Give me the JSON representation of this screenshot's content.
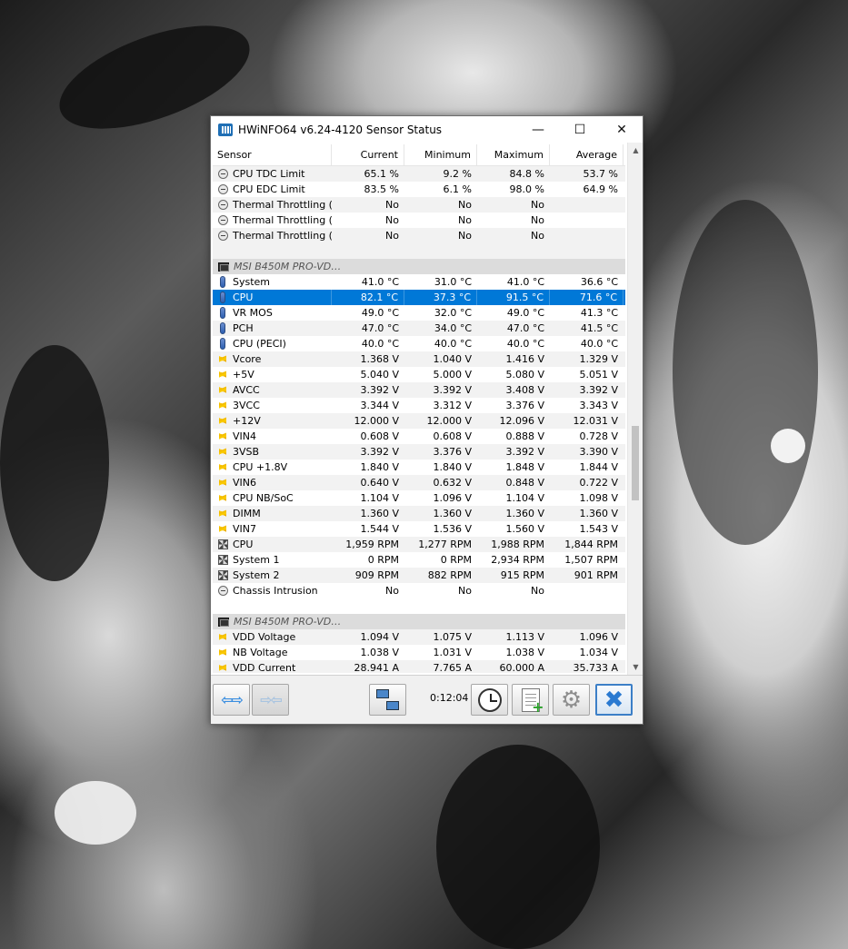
{
  "window": {
    "title": "HWiNFO64 v6.24-4120 Sensor Status",
    "minimize": "—",
    "maximize": "☐",
    "close": "✕"
  },
  "columns": [
    "Sensor",
    "Current",
    "Minimum",
    "Maximum",
    "Average"
  ],
  "rows": [
    {
      "type": "data",
      "icon": "limit-icon",
      "name": "CPU TDC Limit",
      "cur": "65.1 %",
      "min": "9.2 %",
      "max": "84.8 %",
      "avg": "53.7 %"
    },
    {
      "type": "data",
      "icon": "limit-icon",
      "name": "CPU EDC Limit",
      "cur": "83.5 %",
      "min": "6.1 %",
      "max": "98.0 %",
      "avg": "64.9 %"
    },
    {
      "type": "data",
      "icon": "limit-icon",
      "name": "Thermal Throttling (…",
      "cur": "No",
      "min": "No",
      "max": "No",
      "avg": ""
    },
    {
      "type": "data",
      "icon": "limit-icon",
      "name": "Thermal Throttling (…",
      "cur": "No",
      "min": "No",
      "max": "No",
      "avg": ""
    },
    {
      "type": "data",
      "icon": "limit-icon",
      "name": "Thermal Throttling (…",
      "cur": "No",
      "min": "No",
      "max": "No",
      "avg": ""
    },
    {
      "type": "blank"
    },
    {
      "type": "group",
      "icon": "chip-icon",
      "name": "MSI B450M PRO-VD…"
    },
    {
      "type": "data",
      "icon": "temp-icon",
      "name": "System",
      "cur": "41.0 °C",
      "min": "31.0 °C",
      "max": "41.0 °C",
      "avg": "36.6 °C"
    },
    {
      "type": "data",
      "icon": "temp-icon",
      "name": "CPU",
      "cur": "82.1 °C",
      "min": "37.3 °C",
      "max": "91.5 °C",
      "avg": "71.6 °C",
      "selected": true
    },
    {
      "type": "data",
      "icon": "temp-icon",
      "name": "VR MOS",
      "cur": "49.0 °C",
      "min": "32.0 °C",
      "max": "49.0 °C",
      "avg": "41.3 °C"
    },
    {
      "type": "data",
      "icon": "temp-icon",
      "name": "PCH",
      "cur": "47.0 °C",
      "min": "34.0 °C",
      "max": "47.0 °C",
      "avg": "41.5 °C"
    },
    {
      "type": "data",
      "icon": "temp-icon",
      "name": "CPU (PECI)",
      "cur": "40.0 °C",
      "min": "40.0 °C",
      "max": "40.0 °C",
      "avg": "40.0 °C"
    },
    {
      "type": "data",
      "icon": "voltage-icon",
      "name": "Vcore",
      "cur": "1.368 V",
      "min": "1.040 V",
      "max": "1.416 V",
      "avg": "1.329 V"
    },
    {
      "type": "data",
      "icon": "voltage-icon",
      "name": "+5V",
      "cur": "5.040 V",
      "min": "5.000 V",
      "max": "5.080 V",
      "avg": "5.051 V"
    },
    {
      "type": "data",
      "icon": "voltage-icon",
      "name": "AVCC",
      "cur": "3.392 V",
      "min": "3.392 V",
      "max": "3.408 V",
      "avg": "3.392 V"
    },
    {
      "type": "data",
      "icon": "voltage-icon",
      "name": "3VCC",
      "cur": "3.344 V",
      "min": "3.312 V",
      "max": "3.376 V",
      "avg": "3.343 V"
    },
    {
      "type": "data",
      "icon": "voltage-icon",
      "name": "+12V",
      "cur": "12.000 V",
      "min": "12.000 V",
      "max": "12.096 V",
      "avg": "12.031 V"
    },
    {
      "type": "data",
      "icon": "voltage-icon",
      "name": "VIN4",
      "cur": "0.608 V",
      "min": "0.608 V",
      "max": "0.888 V",
      "avg": "0.728 V"
    },
    {
      "type": "data",
      "icon": "voltage-icon",
      "name": "3VSB",
      "cur": "3.392 V",
      "min": "3.376 V",
      "max": "3.392 V",
      "avg": "3.390 V"
    },
    {
      "type": "data",
      "icon": "voltage-icon",
      "name": "CPU +1.8V",
      "cur": "1.840 V",
      "min": "1.840 V",
      "max": "1.848 V",
      "avg": "1.844 V"
    },
    {
      "type": "data",
      "icon": "voltage-icon",
      "name": "VIN6",
      "cur": "0.640 V",
      "min": "0.632 V",
      "max": "0.848 V",
      "avg": "0.722 V"
    },
    {
      "type": "data",
      "icon": "voltage-icon",
      "name": "CPU NB/SoC",
      "cur": "1.104 V",
      "min": "1.096 V",
      "max": "1.104 V",
      "avg": "1.098 V"
    },
    {
      "type": "data",
      "icon": "voltage-icon",
      "name": "DIMM",
      "cur": "1.360 V",
      "min": "1.360 V",
      "max": "1.360 V",
      "avg": "1.360 V"
    },
    {
      "type": "data",
      "icon": "voltage-icon",
      "name": "VIN7",
      "cur": "1.544 V",
      "min": "1.536 V",
      "max": "1.560 V",
      "avg": "1.543 V"
    },
    {
      "type": "data",
      "icon": "fan-icon",
      "name": "CPU",
      "cur": "1,959 RPM",
      "min": "1,277 RPM",
      "max": "1,988 RPM",
      "avg": "1,844 RPM"
    },
    {
      "type": "data",
      "icon": "fan-icon",
      "name": "System 1",
      "cur": "0 RPM",
      "min": "0 RPM",
      "max": "2,934 RPM",
      "avg": "1,507 RPM"
    },
    {
      "type": "data",
      "icon": "fan-icon",
      "name": "System 2",
      "cur": "909 RPM",
      "min": "882 RPM",
      "max": "915 RPM",
      "avg": "901 RPM"
    },
    {
      "type": "data",
      "icon": "limit-icon",
      "name": "Chassis Intrusion",
      "cur": "No",
      "min": "No",
      "max": "No",
      "avg": ""
    },
    {
      "type": "blankw"
    },
    {
      "type": "group",
      "icon": "chip-icon",
      "name": "MSI B450M PRO-VD…"
    },
    {
      "type": "data",
      "icon": "voltage-icon",
      "name": "VDD Voltage",
      "cur": "1.094 V",
      "min": "1.075 V",
      "max": "1.113 V",
      "avg": "1.096 V"
    },
    {
      "type": "data",
      "icon": "voltage-icon",
      "name": "NB Voltage",
      "cur": "1.038 V",
      "min": "1.031 V",
      "max": "1.038 V",
      "avg": "1.034 V"
    },
    {
      "type": "data",
      "icon": "voltage-icon",
      "name": "VDD Current",
      "cur": "28.941 A",
      "min": "7.765 A",
      "max": "60.000 A",
      "avg": "35.733 A"
    }
  ],
  "toolbar": {
    "timer": "0:12:04"
  },
  "icons": {
    "expand": "arrows-expand-icon",
    "collapse": "arrows-collapse-icon",
    "network": "network-icon",
    "clock": "clock-icon",
    "log": "log-file-icon",
    "settings": "gear-icon",
    "close": "close-icon"
  },
  "colors": {
    "selection": "#0078d7",
    "accent": "#3c7fc7"
  }
}
